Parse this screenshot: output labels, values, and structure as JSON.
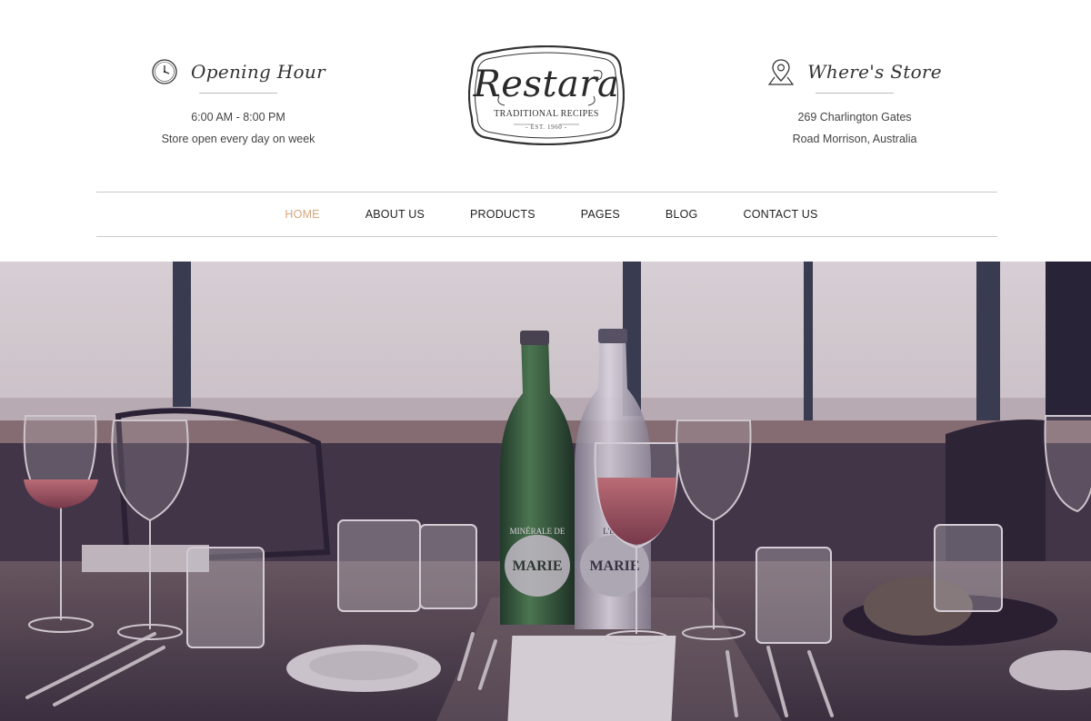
{
  "header": {
    "opening": {
      "title": "Opening Hour",
      "line1": "6:00 AM - 8:00 PM",
      "line2": "Store open every day on week",
      "icon": "clock-icon"
    },
    "store": {
      "title": "Where's Store",
      "line1": "269 Charlington Gates",
      "line2": "Road Morrison, Australia",
      "icon": "map-pin-icon"
    },
    "logo": {
      "name": "Restara",
      "tagline": "TRADITIONAL RECIPES",
      "est": "- EST. 1960 -"
    }
  },
  "nav": {
    "items": [
      {
        "label": "HOME",
        "active": true
      },
      {
        "label": "ABOUT US"
      },
      {
        "label": "PRODUCTS"
      },
      {
        "label": "PAGES"
      },
      {
        "label": "BLOG"
      },
      {
        "label": "CONTACT US"
      }
    ]
  },
  "hero": {
    "bottle_left_label": "MARIE",
    "bottle_right_label": "MARIE",
    "bottle_left_text": "MINÉRALE DE",
    "bottle_right_text": "L'EAU"
  },
  "colors": {
    "accent": "#d6a77d",
    "text": "#333333",
    "rule": "#c9c9c9"
  }
}
